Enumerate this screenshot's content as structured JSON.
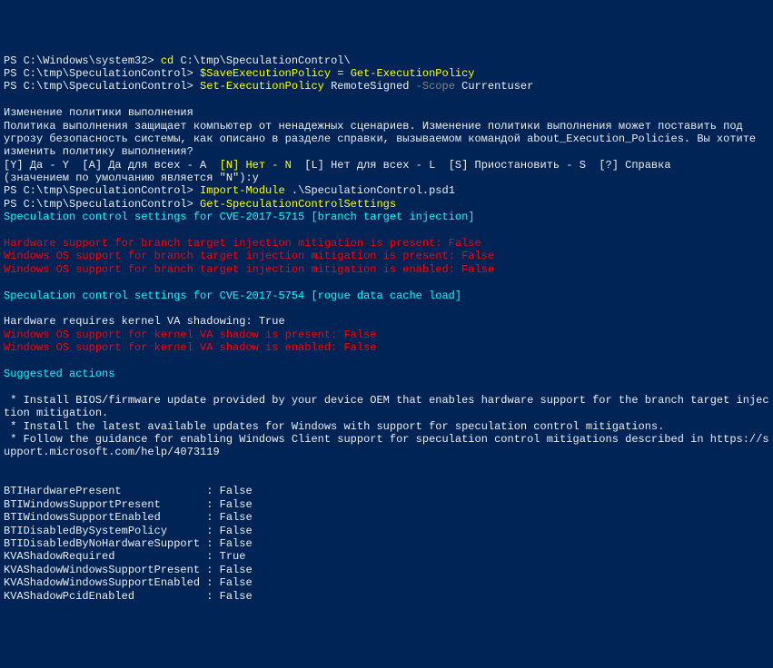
{
  "lines": [
    {
      "segments": [
        {
          "class": "white",
          "text": "PS C:\\Windows\\system32> "
        },
        {
          "class": "yellow",
          "text": "cd "
        },
        {
          "class": "white",
          "text": "C:\\tmp\\SpeculationControl\\"
        }
      ]
    },
    {
      "segments": [
        {
          "class": "white",
          "text": "PS C:\\tmp\\SpeculationControl> "
        },
        {
          "class": "yellow",
          "text": "$SaveExecutionPolicy "
        },
        {
          "class": "white",
          "text": "= "
        },
        {
          "class": "yellow",
          "text": "Get-ExecutionPolicy"
        }
      ]
    },
    {
      "segments": [
        {
          "class": "white",
          "text": "PS C:\\tmp\\SpeculationControl> "
        },
        {
          "class": "yellow",
          "text": "Set-ExecutionPolicy "
        },
        {
          "class": "white",
          "text": "RemoteSigned "
        },
        {
          "class": "gray",
          "text": "-Scope "
        },
        {
          "class": "white",
          "text": "Currentuser"
        }
      ]
    },
    {
      "segments": [
        {
          "class": "white",
          "text": ""
        }
      ]
    },
    {
      "segments": [
        {
          "class": "white",
          "text": "Изменение политики выполнения"
        }
      ]
    },
    {
      "segments": [
        {
          "class": "white",
          "text": "Политика выполнения защищает компьютер от ненадежных сценариев. Изменение политики выполнения может поставить под"
        }
      ]
    },
    {
      "segments": [
        {
          "class": "white",
          "text": "угрозу безопасность системы, как описано в разделе справки, вызываемом командой about_Execution_Policies. Вы хотите"
        }
      ]
    },
    {
      "segments": [
        {
          "class": "white",
          "text": "изменить политику выполнения?"
        }
      ]
    },
    {
      "segments": [
        {
          "class": "white",
          "text": "[Y] Да - Y  [A] Да для всех - A  "
        },
        {
          "class": "yellow",
          "text": "[N] Нет - N"
        },
        {
          "class": "white",
          "text": "  [L] Нет для всех - L  [S] Приостановить - S  [?] Справка"
        }
      ]
    },
    {
      "segments": [
        {
          "class": "white",
          "text": "(значением по умолчанию является \"N\"):y"
        }
      ]
    },
    {
      "segments": [
        {
          "class": "white",
          "text": "PS C:\\tmp\\SpeculationControl> "
        },
        {
          "class": "yellow",
          "text": "Import-Module "
        },
        {
          "class": "white",
          "text": ".\\SpeculationControl.psd1"
        }
      ]
    },
    {
      "segments": [
        {
          "class": "white",
          "text": "PS C:\\tmp\\SpeculationControl> "
        },
        {
          "class": "yellow",
          "text": "Get-SpeculationControlSettings"
        }
      ]
    },
    {
      "segments": [
        {
          "class": "cyan",
          "text": "Speculation control settings for CVE-2017-5715 [branch target injection]"
        }
      ]
    },
    {
      "segments": [
        {
          "class": "white",
          "text": ""
        }
      ]
    },
    {
      "segments": [
        {
          "class": "red",
          "text": "Hardware support for branch target injection mitigation is present: False"
        }
      ]
    },
    {
      "segments": [
        {
          "class": "red",
          "text": "Windows OS support for branch target injection mitigation is present: False"
        }
      ]
    },
    {
      "segments": [
        {
          "class": "red",
          "text": "Windows OS support for branch target injection mitigation is enabled: False"
        }
      ]
    },
    {
      "segments": [
        {
          "class": "white",
          "text": ""
        }
      ]
    },
    {
      "segments": [
        {
          "class": "cyan",
          "text": "Speculation control settings for CVE-2017-5754 [rogue data cache load]"
        }
      ]
    },
    {
      "segments": [
        {
          "class": "white",
          "text": ""
        }
      ]
    },
    {
      "segments": [
        {
          "class": "white",
          "text": "Hardware requires kernel VA shadowing: True"
        }
      ]
    },
    {
      "segments": [
        {
          "class": "red",
          "text": "Windows OS support for kernel VA shadow is present: False"
        }
      ]
    },
    {
      "segments": [
        {
          "class": "red",
          "text": "Windows OS support for kernel VA shadow is enabled: False"
        }
      ]
    },
    {
      "segments": [
        {
          "class": "white",
          "text": ""
        }
      ]
    },
    {
      "segments": [
        {
          "class": "cyan",
          "text": "Suggested actions"
        }
      ]
    },
    {
      "segments": [
        {
          "class": "white",
          "text": ""
        }
      ]
    },
    {
      "segments": [
        {
          "class": "white",
          "text": " * Install BIOS/firmware update provided by your device OEM that enables hardware support for the branch target injection mitigation."
        }
      ]
    },
    {
      "segments": [
        {
          "class": "white",
          "text": " * Install the latest available updates for Windows with support for speculation control mitigations."
        }
      ]
    },
    {
      "segments": [
        {
          "class": "white",
          "text": " * Follow the guidance for enabling Windows Client support for speculation control mitigations described in https://support.microsoft.com/help/4073119"
        }
      ]
    },
    {
      "segments": [
        {
          "class": "white",
          "text": ""
        }
      ]
    },
    {
      "segments": [
        {
          "class": "white",
          "text": ""
        }
      ]
    },
    {
      "segments": [
        {
          "class": "white",
          "text": "BTIHardwarePresent             : False"
        }
      ]
    },
    {
      "segments": [
        {
          "class": "white",
          "text": "BTIWindowsSupportPresent       : False"
        }
      ]
    },
    {
      "segments": [
        {
          "class": "white",
          "text": "BTIWindowsSupportEnabled       : False"
        }
      ]
    },
    {
      "segments": [
        {
          "class": "white",
          "text": "BTIDisabledBySystemPolicy      : False"
        }
      ]
    },
    {
      "segments": [
        {
          "class": "white",
          "text": "BTIDisabledByNoHardwareSupport : False"
        }
      ]
    },
    {
      "segments": [
        {
          "class": "white",
          "text": "KVAShadowRequired              : True"
        }
      ]
    },
    {
      "segments": [
        {
          "class": "white",
          "text": "KVAShadowWindowsSupportPresent : False"
        }
      ]
    },
    {
      "segments": [
        {
          "class": "white",
          "text": "KVAShadowWindowsSupportEnabled : False"
        }
      ]
    },
    {
      "segments": [
        {
          "class": "white",
          "text": "KVAShadowPcidEnabled           : False"
        }
      ]
    }
  ]
}
